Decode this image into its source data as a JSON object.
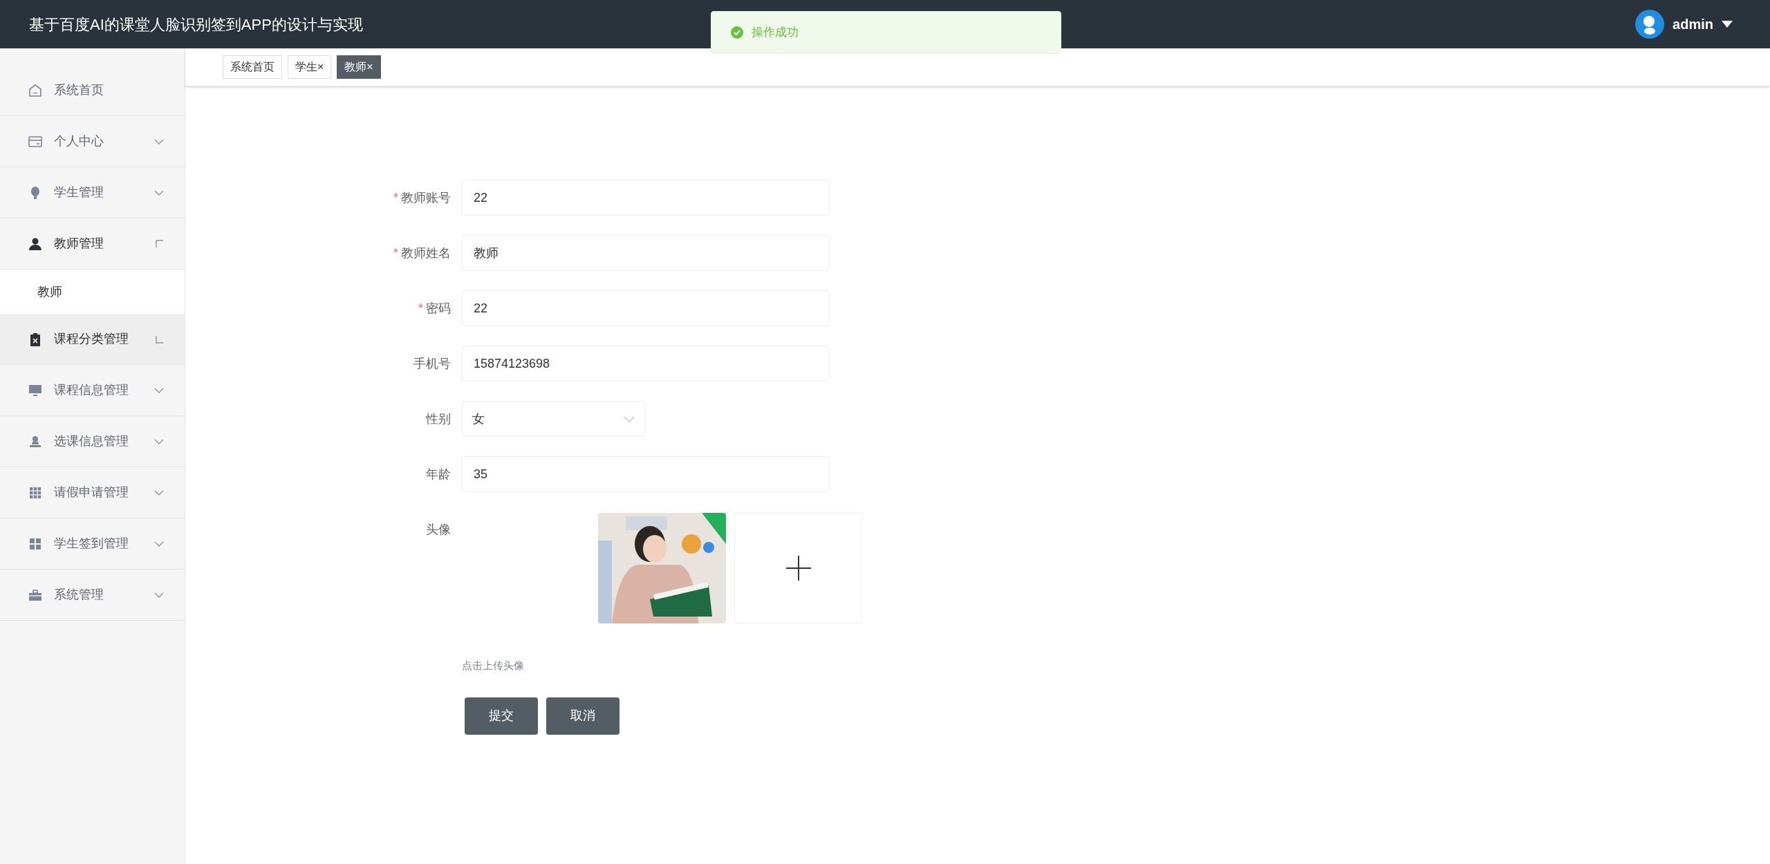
{
  "header": {
    "title": "基于百度AI的课堂人脸识别签到APP的设计与实现",
    "user": "admin"
  },
  "toast": {
    "message": "操作成功"
  },
  "sidebar": {
    "items": [
      {
        "label": "系统首页",
        "kind": "link"
      },
      {
        "label": "个人中心",
        "kind": "submenu",
        "expanded": false,
        "hovered": false
      },
      {
        "label": "学生管理",
        "kind": "submenu",
        "expanded": false,
        "hovered": false
      },
      {
        "label": "教师管理",
        "kind": "submenu",
        "expanded": true,
        "hovered": false,
        "children": [
          {
            "label": "教师"
          }
        ]
      },
      {
        "label": "课程分类管理",
        "kind": "submenu",
        "expanded": false,
        "hovered": true
      },
      {
        "label": "课程信息管理",
        "kind": "submenu",
        "expanded": false,
        "hovered": false
      },
      {
        "label": "选课信息管理",
        "kind": "submenu",
        "expanded": false,
        "hovered": false
      },
      {
        "label": "请假申请管理",
        "kind": "submenu",
        "expanded": false,
        "hovered": false
      },
      {
        "label": "学生签到管理",
        "kind": "submenu",
        "expanded": false,
        "hovered": false
      },
      {
        "label": "系统管理",
        "kind": "submenu",
        "expanded": false,
        "hovered": false
      }
    ]
  },
  "tabs": [
    {
      "label": "系统首页",
      "selected": false
    },
    {
      "label": "学生",
      "close": "×",
      "selected": false
    },
    {
      "label": "教师",
      "close": "×",
      "selected": true
    }
  ],
  "form": {
    "fields": [
      {
        "label": "教师账号",
        "kind": "input",
        "required_mark": "*",
        "value": "22"
      },
      {
        "label": "教师姓名",
        "kind": "input",
        "required_mark": "*",
        "value": "教师"
      },
      {
        "label": "密码",
        "kind": "input",
        "required_mark": "*",
        "value": "22"
      },
      {
        "label": "手机号",
        "kind": "input",
        "value": "15874123698"
      },
      {
        "label": "性别",
        "kind": "select",
        "value": "女"
      },
      {
        "label": "年龄",
        "kind": "input",
        "value": "35"
      },
      {
        "label": "头像",
        "kind": "upload",
        "hint": "点击上传头像"
      }
    ],
    "buttons": [
      "提交",
      "取消"
    ]
  }
}
